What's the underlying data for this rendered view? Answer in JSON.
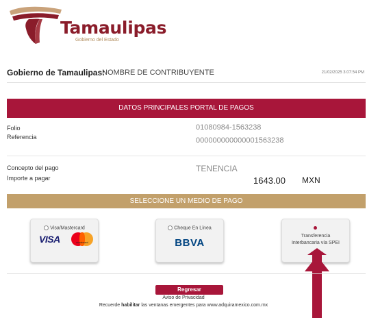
{
  "brand": {
    "name": "Tamaulipas",
    "subtitle": "Gobierno del Estado"
  },
  "header": {
    "org_label": "Gobierno de Tamaulipas:",
    "taxpayer": "NOMBRE DE CONTRIBUYENTE",
    "date": "21/02/2025 3:07:54 PM"
  },
  "section_main": {
    "title": "DATOS PRINCIPALES PORTAL DE PAGOS",
    "folio_label": "Folio",
    "folio_value": "01080984-1563238",
    "ref_label": "Referencia",
    "ref_value": "000000000000001563238",
    "concept_label": "Concepto del pago",
    "concept_value": "TENENCIA",
    "amount_label": "Importe a pagar",
    "amount_value": "1643.00",
    "currency": "MXN"
  },
  "section_payment": {
    "title": "SELECCIONE UN MEDIO DE PAGO",
    "options": [
      {
        "label": "Visa/Mastercard",
        "logo_text": "VISA",
        "mc_text": "mastercard"
      },
      {
        "label": "Cheque En Línea",
        "logo_text": "BBVA"
      },
      {
        "label_line1": "Transferencia",
        "label_line2": "Interbancaria vía SPEI"
      }
    ],
    "selected_option": 2
  },
  "footer": {
    "back_button": "Regresar",
    "privacy": "Aviso de Privacidad",
    "note_pre": "Recuerde",
    "note_bold": "habilitar",
    "note_post": "las ventanas emergentes para www.adquiramexico.com.mx"
  },
  "colors": {
    "primary": "#a8163a",
    "gold": "#c2a06b",
    "brand_text": "#8a1c2a"
  },
  "icons": [
    "tamaulipas-logo-icon",
    "mastercard-icon",
    "arrow-indicator-icon"
  ]
}
